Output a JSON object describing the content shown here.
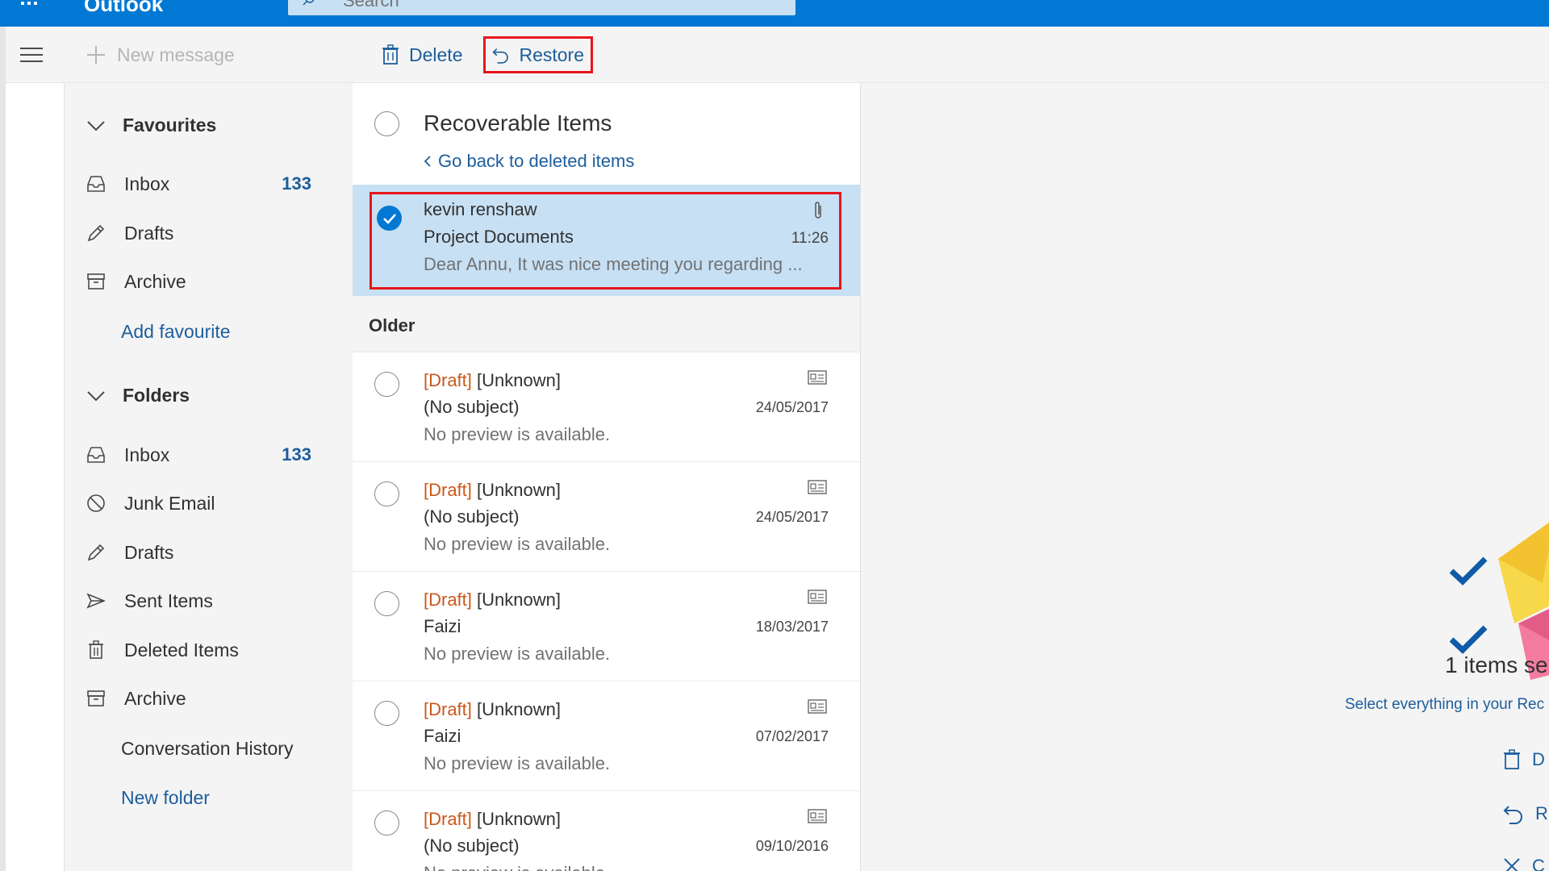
{
  "app": {
    "name": "Outlook"
  },
  "search": {
    "placeholder": "Search"
  },
  "toolbar": {
    "new_message": "New message",
    "delete": "Delete",
    "restore": "Restore"
  },
  "nav": {
    "favourites_label": "Favourites",
    "favourites": [
      {
        "label": "Inbox",
        "count": "133",
        "icon": "inbox-icon"
      },
      {
        "label": "Drafts",
        "count": "",
        "icon": "pencil-icon"
      },
      {
        "label": "Archive",
        "count": "",
        "icon": "archive-icon"
      }
    ],
    "add_favourite": "Add favourite",
    "folders_label": "Folders",
    "folders": [
      {
        "label": "Inbox",
        "count": "133",
        "icon": "inbox-icon"
      },
      {
        "label": "Junk Email",
        "count": "",
        "icon": "block-icon"
      },
      {
        "label": "Drafts",
        "count": "",
        "icon": "pencil-icon"
      },
      {
        "label": "Sent Items",
        "count": "",
        "icon": "send-icon"
      },
      {
        "label": "Deleted Items",
        "count": "",
        "icon": "trash-icon"
      },
      {
        "label": "Archive",
        "count": "",
        "icon": "archive-icon"
      }
    ],
    "conversation_history": "Conversation History",
    "new_folder": "New folder"
  },
  "list": {
    "title": "Recoverable Items",
    "go_back": "Go back to deleted items",
    "selected": {
      "from": "kevin renshaw",
      "subject": "Project Documents",
      "time": "11:26",
      "preview": "Dear Annu, It was nice meeting you regarding ..."
    },
    "older_label": "Older",
    "messages": [
      {
        "draft": "[Draft]",
        "from": "[Unknown]",
        "subject": "(No subject)",
        "date": "24/05/2017",
        "preview": "No preview is available."
      },
      {
        "draft": "[Draft]",
        "from": "[Unknown]",
        "subject": "(No subject)",
        "date": "24/05/2017",
        "preview": "No preview is available."
      },
      {
        "draft": "[Draft]",
        "from": "[Unknown]",
        "subject": "Faizi",
        "date": "18/03/2017",
        "preview": "No preview is available."
      },
      {
        "draft": "[Draft]",
        "from": "[Unknown]",
        "subject": "Faizi",
        "date": "07/02/2017",
        "preview": "No preview is available."
      },
      {
        "draft": "[Draft]",
        "from": "[Unknown]",
        "subject": "(No subject)",
        "date": "09/10/2016",
        "preview": "No preview is available."
      }
    ]
  },
  "reading": {
    "items_selected": "1 items sel",
    "select_all": "Select everything in your Rec",
    "action_1": "D",
    "action_2": "R",
    "action_3": "C"
  },
  "colors": {
    "accent": "#0078d4",
    "highlight": "#e8151b",
    "draft": "#c9581d",
    "link": "#1c5e9c",
    "selected_bg": "#c7e0f4"
  }
}
